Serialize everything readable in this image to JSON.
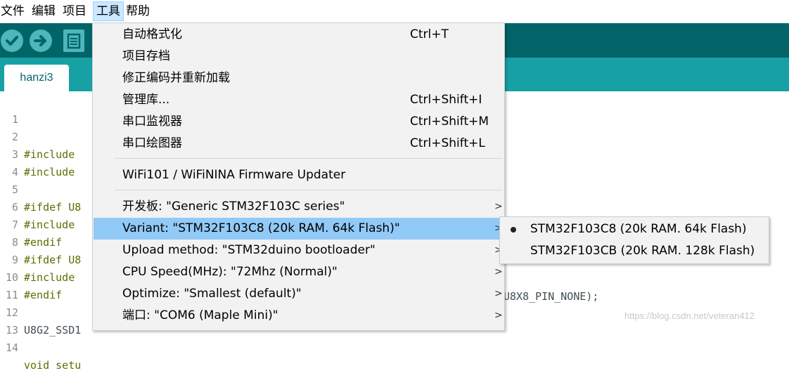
{
  "menubar": {
    "items": [
      {
        "label": "文件"
      },
      {
        "label": "编辑"
      },
      {
        "label": "项目"
      },
      {
        "label": "工具"
      },
      {
        "label": "帮助"
      }
    ]
  },
  "toolbar": {
    "verify_icon": "check-icon",
    "upload_icon": "arrow-right-icon",
    "new_icon": "file-icon"
  },
  "tab": {
    "label": "hanzi3"
  },
  "editor": {
    "lines": [
      {
        "num": "1",
        "text": ""
      },
      {
        "num": "2",
        "text": "#include"
      },
      {
        "num": "3",
        "text": "#include"
      },
      {
        "num": "4",
        "text": ""
      },
      {
        "num": "5",
        "text": "#ifdef U8"
      },
      {
        "num": "6",
        "text": "#include"
      },
      {
        "num": "7",
        "text": "#endif"
      },
      {
        "num": "8",
        "text": "#ifdef U8"
      },
      {
        "num": "9",
        "text": "#include"
      },
      {
        "num": "10",
        "text": "#endif"
      },
      {
        "num": "11",
        "text": ""
      },
      {
        "num": "12",
        "text": "U8G2_SSD1"
      },
      {
        "num": "13",
        "text": ""
      },
      {
        "num": "14",
        "text": "void setu"
      }
    ],
    "line12_tail": "U8X8_PIN_NONE);"
  },
  "menu": {
    "items": [
      {
        "label": "自动格式化",
        "shortcut": "Ctrl+T"
      },
      {
        "label": "项目存档",
        "shortcut": ""
      },
      {
        "label": "修正编码并重新加载",
        "shortcut": ""
      },
      {
        "label": "管理库...",
        "shortcut": "Ctrl+Shift+I"
      },
      {
        "label": "串口监视器",
        "shortcut": "Ctrl+Shift+M"
      },
      {
        "label": "串口绘图器",
        "shortcut": "Ctrl+Shift+L"
      },
      {
        "label": "WiFi101 / WiFiNINA Firmware Updater",
        "shortcut": ""
      },
      {
        "label": "开发板: \"Generic STM32F103C series\"",
        "arrow": ">"
      },
      {
        "label": "Variant: \"STM32F103C8 (20k RAM. 64k Flash)\"",
        "arrow": ">"
      },
      {
        "label": "Upload method: \"STM32duino bootloader\"",
        "arrow": ">"
      },
      {
        "label": "CPU Speed(MHz): \"72Mhz (Normal)\"",
        "arrow": ">"
      },
      {
        "label": "Optimize: \"Smallest (default)\"",
        "arrow": ">"
      },
      {
        "label": "端口: \"COM6 (Maple Mini)\"",
        "arrow": ">"
      }
    ]
  },
  "submenu": {
    "items": [
      {
        "label": "STM32F103C8 (20k RAM. 64k Flash)",
        "selected": true
      },
      {
        "label": "STM32F103CB (20k RAM. 128k Flash)",
        "selected": false
      }
    ]
  },
  "watermark": "https://blog.csdn.net/veteran412",
  "colors": {
    "toolbar": "#006468",
    "tabbar": "#17a1a5",
    "highlight": "#91c9f7",
    "menu_bg": "#f2f2f2"
  }
}
